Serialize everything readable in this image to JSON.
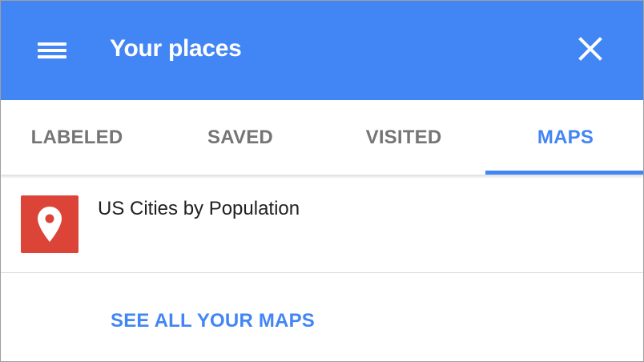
{
  "header": {
    "title": "Your places",
    "menu_icon": "hamburger-menu-icon",
    "close_icon": "close-icon",
    "background_color": "#4285f4"
  },
  "tabs": [
    {
      "label": "LABELED",
      "active": false
    },
    {
      "label": "SAVED",
      "active": false
    },
    {
      "label": "VISITED",
      "active": false
    },
    {
      "label": "MAPS",
      "active": true
    }
  ],
  "maps": [
    {
      "name": "US Cities by Population",
      "icon": "map-pin-icon",
      "icon_color": "#db4437"
    }
  ],
  "footer": {
    "see_all_label": "SEE ALL YOUR MAPS"
  },
  "colors": {
    "accent": "#4285f4",
    "inactive_tab": "#757575",
    "text": "#212121"
  }
}
